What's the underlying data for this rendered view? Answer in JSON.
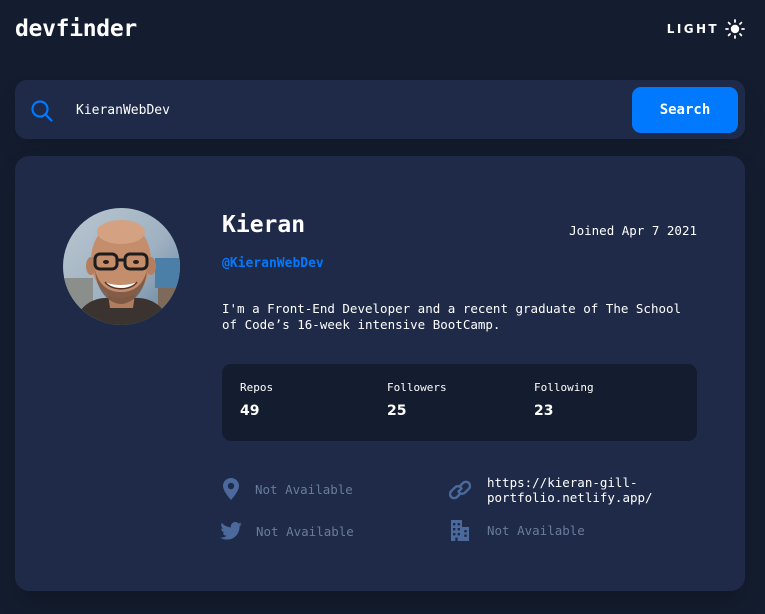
{
  "header": {
    "logo": "devfinder",
    "theme_toggle_label": "LIGHT",
    "theme_icon": "sun-icon"
  },
  "search": {
    "icon": "search-icon",
    "value": "KieranWebDev",
    "button_label": "Search"
  },
  "profile": {
    "name": "Kieran",
    "joined": "Joined Apr 7 2021",
    "handle": "@KieranWebDev",
    "bio": "I'm a Front-End Developer and a recent graduate of The School of Code’s 16-week intensive BootCamp.",
    "stats": [
      {
        "label": "Repos",
        "value": "49"
      },
      {
        "label": "Followers",
        "value": "25"
      },
      {
        "label": "Following",
        "value": "23"
      }
    ],
    "links": {
      "location": {
        "icon": "location-pin-icon",
        "text": "Not Available"
      },
      "website": {
        "icon": "link-icon",
        "text": "https://kieran-gill-portfolio.netlify.app/"
      },
      "twitter": {
        "icon": "twitter-icon",
        "text": "Not Available"
      },
      "company": {
        "icon": "office-building-icon",
        "text": "Not Available"
      }
    }
  },
  "colors": {
    "background": "#141d2f",
    "card": "#1e2a47",
    "accent": "#0079ff",
    "muted": "#697c9a",
    "icon_muted": "#4b6a9b"
  }
}
